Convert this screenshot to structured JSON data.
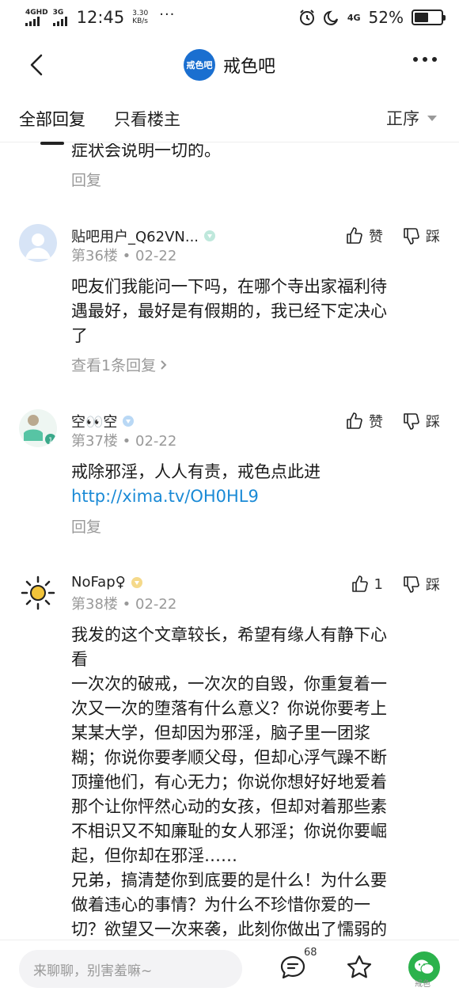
{
  "status_bar": {
    "net1": "4GHD",
    "net2": "3G",
    "time": "12:45",
    "speed_value": "3.30",
    "speed_unit": "KB/s",
    "dots": "···",
    "net3": "4G",
    "battery_percent": "52%",
    "battery_level": 0.52
  },
  "nav": {
    "logo_text": "戒色吧",
    "title": "戒色吧"
  },
  "tabs": {
    "all_replies": "全部回复",
    "op_only": "只看楼主",
    "sort": "正序"
  },
  "fragment": {
    "text": "症状会说明一切的。",
    "reply": "回复"
  },
  "posts": [
    {
      "username": "贴吧用户_Q62VN...",
      "floor": "第36楼",
      "sep": "•",
      "date": "02-22",
      "like": "赞",
      "dislike": "踩",
      "lines": [
        "吧友们我能问一下吗，在哪个寺出家福利待",
        "遇最好，最好是有假期的，我已经下定决心",
        "了"
      ],
      "more_replies": "查看1条回复"
    },
    {
      "username": "空👀空",
      "floor": "第37楼",
      "sep": "•",
      "date": "02-22",
      "like": "赞",
      "dislike": "踩",
      "lines": [
        "戒除邪淫，人人有责，戒色点此进"
      ],
      "link": "http://xima.tv/OH0HL9",
      "reply": "回复"
    },
    {
      "username": "NoFap♀",
      "floor": "第38楼",
      "sep": "•",
      "date": "02-22",
      "like": "1",
      "dislike": "踩",
      "lines": [
        "我发的这个文章较长，希望有缘人有静下心",
        "看",
        "一次次的破戒，一次次的自毁，你重复着一",
        "次又一次的堕落有什么意义？你说你要考上",
        "某某大学，但却因为邪淫，脑子里一团浆",
        "糊；你说你要孝顺父母，但却心浮气躁不断",
        "顶撞他们，有心无力；你说你想好好地爱着",
        "那个让你怦然心动的女孩，但却对着那些素",
        "不相识又不知廉耻的女人邪淫；你说你要崛",
        "起，但你却在邪淫……",
        "兄弟，搞清楚你到底要的是什么！为什么要",
        "做着违心的事情？为什么不珍惜你爱的一",
        "切？欲望又一次来袭，此刻你做出了懦弱的"
      ]
    }
  ],
  "bottom": {
    "placeholder": "来聊聊，别害羞嘛~",
    "comment_count": "68",
    "watermark": "戒色"
  }
}
